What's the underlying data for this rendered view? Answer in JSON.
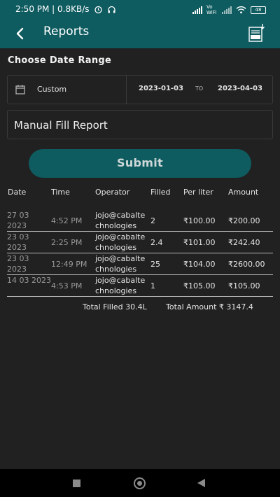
{
  "status_bar": {
    "time_speed": "2:50 PM | 0.8KB/s",
    "network_label": "Vo WiFi",
    "battery": "48"
  },
  "appbar": {
    "title": "Reports",
    "back_icon": "arrow-back-icon",
    "export_icon": "pdf-download-icon"
  },
  "filters": {
    "section_title": "Choose Date Range",
    "range_type": "Custom",
    "from_date": "2023-01-03",
    "to_label": "TO",
    "to_date": "2023-04-03",
    "report_type": "Manual Fill Report",
    "submit_label": "Submit"
  },
  "table": {
    "headers": [
      "Date",
      "Time",
      "Operator",
      "Filled",
      "Per liter",
      "Amount"
    ],
    "rows": [
      {
        "date": "27 03 2023",
        "time": "4:52 PM",
        "operator": "jojo@cabaltechnologies",
        "filled": "2",
        "per_liter": "₹100.00",
        "amount": "₹200.00"
      },
      {
        "date": "23 03 2023",
        "time": "2:25 PM",
        "operator": "jojo@cabaltechnologies",
        "filled": "2.4",
        "per_liter": "₹101.00",
        "amount": "₹242.40"
      },
      {
        "date": "23 03 2023",
        "time": "12:49 PM",
        "operator": "jojo@cabaltechnologies",
        "filled": "25",
        "per_liter": "₹104.00",
        "amount": "₹2600.00"
      },
      {
        "date": "14 03 2023",
        "time": "4:53 PM",
        "operator": "jojo@cabaltechnologies",
        "filled": "1",
        "per_liter": "₹105.00",
        "amount": "₹105.00"
      }
    ]
  },
  "totals": {
    "filled": "Total Filled 30.4L",
    "amount": "Total Amount ₹ 3147.4"
  },
  "colors": {
    "primary": "#0e5b60",
    "background": "#212121"
  }
}
